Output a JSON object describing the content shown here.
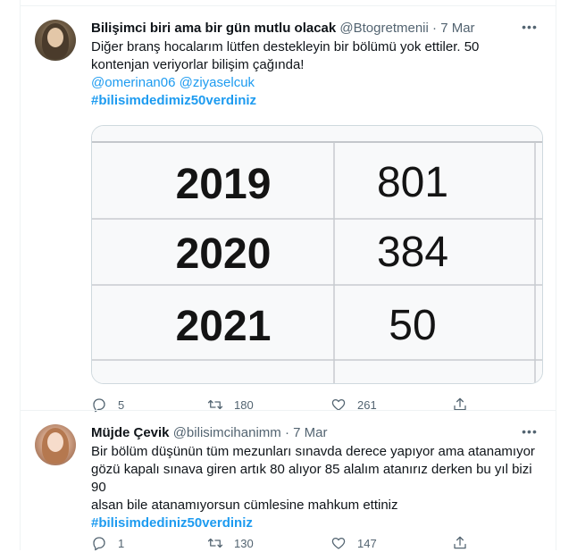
{
  "tweets": [
    {
      "author": {
        "name": "Bilişimci biri ama bir gün mutlu olacak",
        "handle": "@Btogretmenii"
      },
      "separator": "·",
      "date": "7 Mar",
      "text_lines": [
        "Diğer branş hocalarım lütfen destekleyin bir bölümü yok ettiler. 50",
        "kontenjan veriyorlar bilişim çağında!"
      ],
      "mentions": "@omerinan06 @ziyaselcuk",
      "hashtag": "#bilisimdedimiz50verdiniz",
      "media_table": {
        "rows": [
          {
            "year": "2019",
            "value": "801"
          },
          {
            "year": "2020",
            "value": "384"
          },
          {
            "year": "2021",
            "value": "50"
          }
        ]
      },
      "counts": {
        "replies": "5",
        "retweets": "180",
        "likes": "261"
      }
    },
    {
      "author": {
        "name": "Müjde Çevik",
        "handle": "@bilisimcihanimm"
      },
      "separator": "·",
      "date": "7 Mar",
      "text_lines": [
        "Bir bölüm düşünün tüm mezunları sınavda derece yapıyor ama atanamıyor",
        "gözü kapalı sınava giren artık 80 alıyor 85 alalım atanırız derken bu yıl bizi 90",
        "alsan bile atanamıyorsun cümlesine mahkum ettiniz"
      ],
      "hashtag": "#bilisimdediniz50verdiniz",
      "counts": {
        "replies": "1",
        "retweets": "130",
        "likes": "147"
      }
    }
  ],
  "colors": {
    "accent": "#1d9bf0",
    "muted": "#536471",
    "text": "#0f1419",
    "border": "#eff3f4"
  },
  "icons": [
    "more-icon",
    "reply-icon",
    "retweet-icon",
    "like-icon",
    "share-icon"
  ]
}
